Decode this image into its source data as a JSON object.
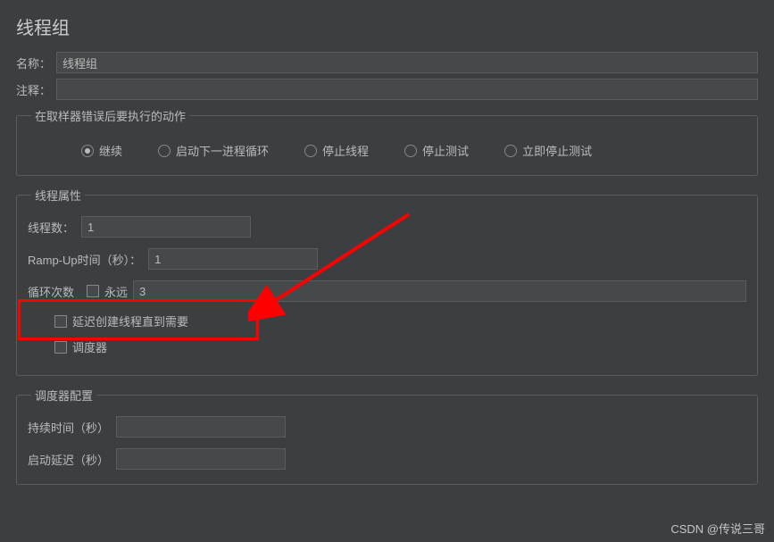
{
  "panel": {
    "title": "线程组"
  },
  "form": {
    "name_label": "名称：",
    "name_value": "线程组",
    "comment_label": "注释：",
    "comment_value": ""
  },
  "error_action": {
    "legend": "在取样器错误后要执行的动作",
    "options": [
      {
        "label": "继续",
        "selected": true
      },
      {
        "label": "启动下一进程循环",
        "selected": false
      },
      {
        "label": "停止线程",
        "selected": false
      },
      {
        "label": "停止测试",
        "selected": false
      },
      {
        "label": "立即停止测试",
        "selected": false
      }
    ]
  },
  "thread_props": {
    "legend": "线程属性",
    "threads_label": "线程数：",
    "threads_value": "1",
    "rampup_label": "Ramp-Up时间（秒）：",
    "rampup_value": "1",
    "loop_label": "循环次数",
    "forever_label": "永远",
    "loop_value": "3",
    "delay_create_label": "延迟创建线程直到需要",
    "scheduler_label": "调度器"
  },
  "scheduler": {
    "legend": "调度器配置",
    "duration_label": "持续时间（秒）",
    "duration_value": "",
    "delay_label": "启动延迟（秒）",
    "delay_value": ""
  },
  "watermark": "CSDN @传说三哥"
}
